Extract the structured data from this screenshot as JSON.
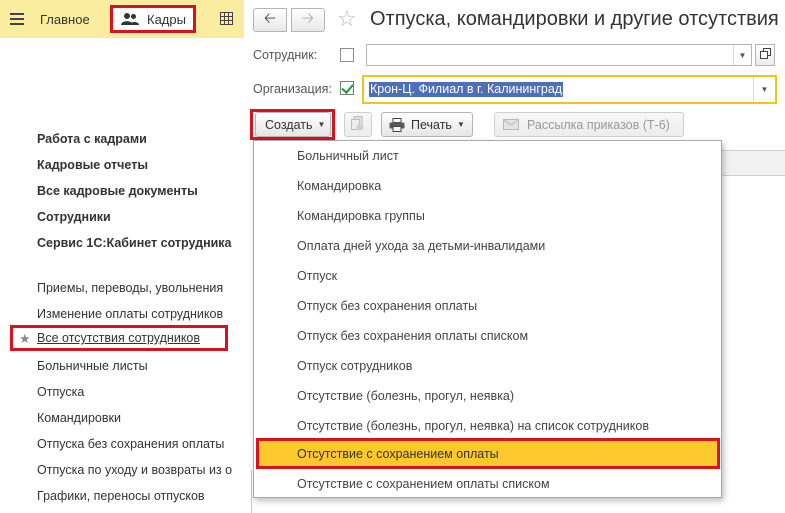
{
  "sections": {
    "main_label": "Главное",
    "kadry_label": "Кадры"
  },
  "leftnav": {
    "bold_items": [
      "Работа с кадрами",
      "Кадровые отчеты",
      "Все кадровые документы",
      "Сотрудники",
      "Сервис 1С:Кабинет сотрудника"
    ],
    "items": [
      "Приемы, переводы, увольнения",
      "Изменение оплаты сотрудников",
      "Все отсутствия сотрудников",
      "Больничные листы",
      "Отпуска",
      "Командировки",
      "Отпуска без сохранения оплаты",
      "Отпуска по уходу и возвраты из о",
      "Графики, переносы отпусков"
    ]
  },
  "form": {
    "title": "Отпуска, командировки и другие отсутствия",
    "employee_label": "Сотрудник:",
    "employee_value": "",
    "org_label": "Организация:",
    "org_value": "Крон-Ц. Филиал в г. Калининград"
  },
  "toolbar": {
    "create_label": "Создать",
    "print_label": "Печать",
    "mail_label": "Рассылка приказов (Т-6)"
  },
  "menu": {
    "items": [
      "Больничный лист",
      "Командировка",
      "Командировка группы",
      "Оплата дней ухода за детьми-инвалидами",
      "Отпуск",
      "Отпуск без сохранения оплаты",
      "Отпуск без сохранения оплаты списком",
      "Отпуск сотрудников",
      "Отсутствие (болезнь, прогул, неявка)",
      "Отсутствие (болезнь, прогул, неявка) на список сотрудников",
      "Отсутствие с сохранением оплаты",
      "Отсутствие с сохранением оплаты списком"
    ]
  },
  "colors": {
    "section_bar": "#fbeda0",
    "highlight_red": "#d8121f",
    "menu_highlight": "#fdc72e",
    "selection_blue": "#4d6fb5",
    "check_green": "#1a9a3a"
  }
}
